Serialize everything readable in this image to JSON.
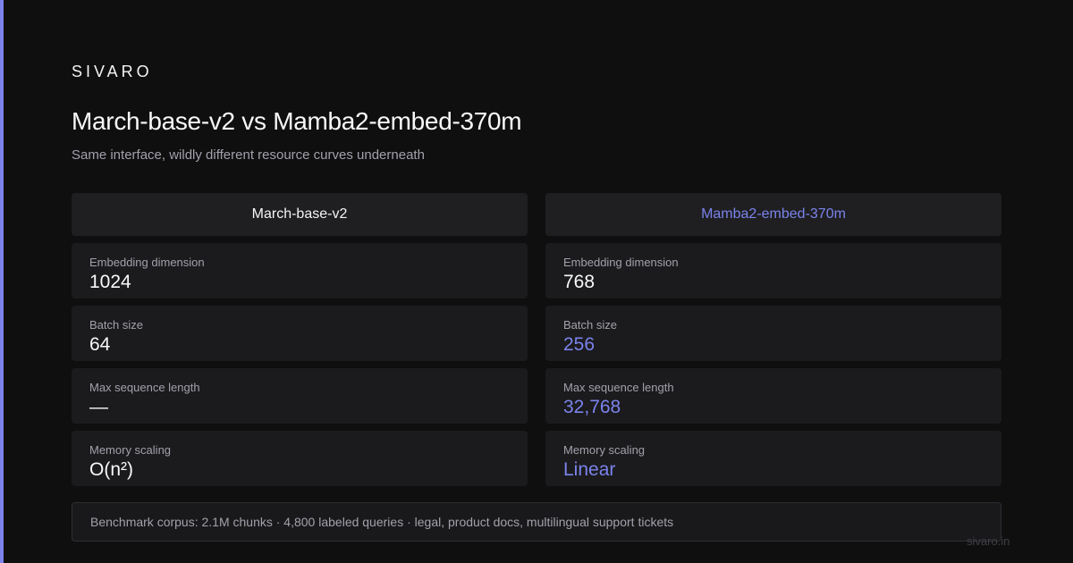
{
  "brand": "SIVARO",
  "title": "March-base-v2 vs Mamba2-embed-370m",
  "subtitle": "Same interface, wildly different resource curves underneath",
  "left": {
    "header": "March-base-v2",
    "metrics": [
      {
        "label": "Embedding dimension",
        "value": "1024"
      },
      {
        "label": "Batch size",
        "value": "64"
      },
      {
        "label": "Max sequence length",
        "value": "—"
      },
      {
        "label": "Memory scaling",
        "value": "O(n²)"
      }
    ]
  },
  "right": {
    "header": "Mamba2-embed-370m",
    "metrics": [
      {
        "label": "Embedding dimension",
        "value": "768"
      },
      {
        "label": "Batch size",
        "value": "256"
      },
      {
        "label": "Max sequence length",
        "value": "32,768"
      },
      {
        "label": "Memory scaling",
        "value": "Linear"
      }
    ]
  },
  "footnote": "Benchmark corpus: 2.1M chunks · 4,800 labeled queries · legal, product docs, multilingual support tickets",
  "site": "sivaro.in",
  "colors": {
    "accent": "#7b83eb",
    "background": "#0f0f10",
    "card": "#1b1b1e",
    "muted_text": "#a1a1aa"
  }
}
